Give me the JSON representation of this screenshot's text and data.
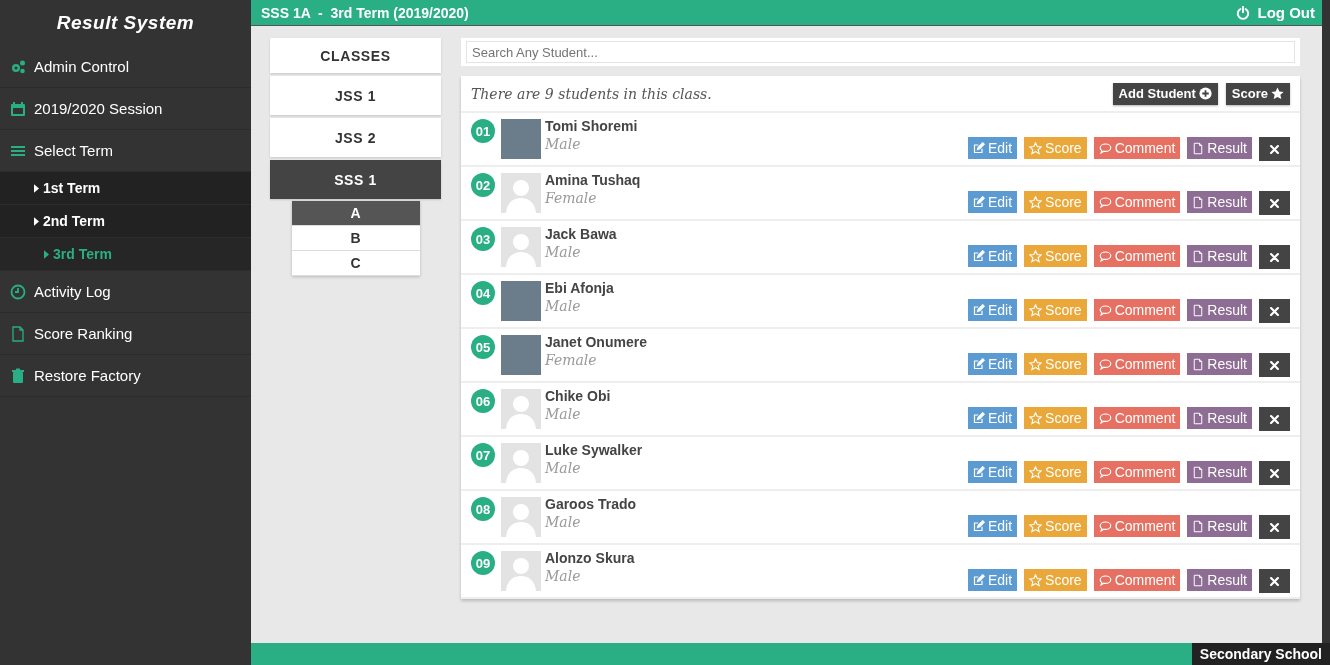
{
  "sidebar": {
    "title": "Result System",
    "items": [
      {
        "label": "Admin Control",
        "kind": "gears"
      },
      {
        "label": "2019/2020 Session",
        "kind": "calendar"
      },
      {
        "label": "Select Term",
        "kind": "bars",
        "children": [
          {
            "label": "1st Term",
            "selected": false
          },
          {
            "label": "2nd Term",
            "selected": false
          },
          {
            "label": "3rd Term",
            "selected": true
          }
        ]
      },
      {
        "label": "Activity Log",
        "kind": "clock"
      },
      {
        "label": "Score Ranking",
        "kind": "file"
      },
      {
        "label": "Restore Factory",
        "kind": "trash"
      }
    ]
  },
  "topbar": {
    "title": "SSS 1A  -  3rd Term (2019/2020)",
    "logout": "Log Out"
  },
  "classes": {
    "heading": "CLASSES",
    "items": [
      {
        "label": "JSS 1",
        "selected": false
      },
      {
        "label": "JSS 2",
        "selected": false
      },
      {
        "label": "SSS 1",
        "selected": true,
        "sections": [
          {
            "label": "A",
            "selected": true
          },
          {
            "label": "B",
            "selected": false
          },
          {
            "label": "C",
            "selected": false
          }
        ]
      }
    ]
  },
  "search": {
    "placeholder": "Search Any Student..."
  },
  "students": {
    "summary": "There are 9 students in this class.",
    "add_button": "Add Student",
    "score_button": "Score",
    "rows": [
      {
        "number": "01",
        "name": "Tomi Shoremi",
        "gender": "Male",
        "has_photo": true,
        "actions": [
          "Edit",
          "Score",
          "Comment",
          "Result"
        ]
      },
      {
        "number": "02",
        "name": "Amina Tushaq",
        "gender": "Female",
        "has_photo": false,
        "actions": [
          "Edit",
          "Score",
          "Comment",
          "Result"
        ]
      },
      {
        "number": "03",
        "name": "Jack Bawa",
        "gender": "Male",
        "has_photo": false,
        "actions": [
          "Edit",
          "Score",
          "Comment",
          "Result"
        ]
      },
      {
        "number": "04",
        "name": "Ebi Afonja",
        "gender": "Male",
        "has_photo": true,
        "actions": [
          "Edit",
          "Score",
          "Comment",
          "Result"
        ]
      },
      {
        "number": "05",
        "name": "Janet Onumere",
        "gender": "Female",
        "has_photo": true,
        "actions": [
          "Edit",
          "Score",
          "Comment",
          "Result"
        ]
      },
      {
        "number": "06",
        "name": "Chike Obi",
        "gender": "Male",
        "has_photo": false,
        "actions": [
          "Edit",
          "Score",
          "Comment",
          "Result"
        ]
      },
      {
        "number": "07",
        "name": "Luke Sywalker",
        "gender": "Male",
        "has_photo": false,
        "actions": [
          "Edit",
          "Score",
          "Comment",
          "Result"
        ]
      },
      {
        "number": "08",
        "name": "Garoos Trado",
        "gender": "Male",
        "has_photo": false,
        "actions": [
          "Edit",
          "Score",
          "Comment",
          "Result"
        ]
      },
      {
        "number": "09",
        "name": "Alonzo Skura",
        "gender": "Male",
        "has_photo": false,
        "actions": [
          "Edit",
          "Score",
          "Comment",
          "Result"
        ]
      }
    ]
  },
  "footer": {
    "label": "Secondary School"
  }
}
